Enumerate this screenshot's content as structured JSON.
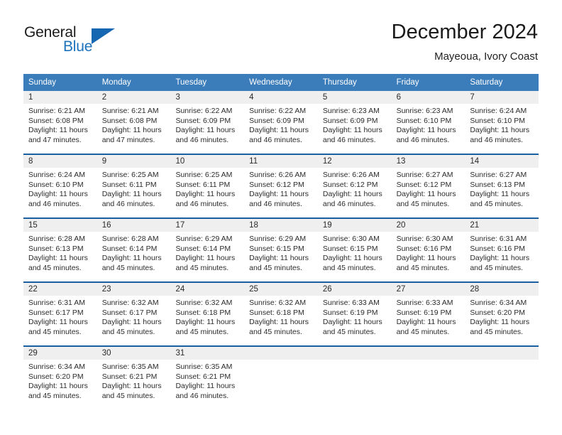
{
  "brand": {
    "name_part1": "General",
    "name_part2": "Blue",
    "triangle_icon": "brand-triangle-icon",
    "accent_color": "#1667b1"
  },
  "header": {
    "title": "December 2024",
    "subtitle": "Mayeoua, Ivory Coast"
  },
  "theme": {
    "header_row_bg": "#3b7cba",
    "week_divider": "#1a5fa0",
    "day_band_bg": "#efefef",
    "text_color": "#2b2b2b"
  },
  "calendar": {
    "weekdays": [
      "Sunday",
      "Monday",
      "Tuesday",
      "Wednesday",
      "Thursday",
      "Friday",
      "Saturday"
    ],
    "weeks": [
      [
        {
          "day": "1",
          "info": "Sunrise: 6:21 AM\nSunset: 6:08 PM\nDaylight: 11 hours\nand 47 minutes."
        },
        {
          "day": "2",
          "info": "Sunrise: 6:21 AM\nSunset: 6:08 PM\nDaylight: 11 hours\nand 47 minutes."
        },
        {
          "day": "3",
          "info": "Sunrise: 6:22 AM\nSunset: 6:09 PM\nDaylight: 11 hours\nand 46 minutes."
        },
        {
          "day": "4",
          "info": "Sunrise: 6:22 AM\nSunset: 6:09 PM\nDaylight: 11 hours\nand 46 minutes."
        },
        {
          "day": "5",
          "info": "Sunrise: 6:23 AM\nSunset: 6:09 PM\nDaylight: 11 hours\nand 46 minutes."
        },
        {
          "day": "6",
          "info": "Sunrise: 6:23 AM\nSunset: 6:10 PM\nDaylight: 11 hours\nand 46 minutes."
        },
        {
          "day": "7",
          "info": "Sunrise: 6:24 AM\nSunset: 6:10 PM\nDaylight: 11 hours\nand 46 minutes."
        }
      ],
      [
        {
          "day": "8",
          "info": "Sunrise: 6:24 AM\nSunset: 6:10 PM\nDaylight: 11 hours\nand 46 minutes."
        },
        {
          "day": "9",
          "info": "Sunrise: 6:25 AM\nSunset: 6:11 PM\nDaylight: 11 hours\nand 46 minutes."
        },
        {
          "day": "10",
          "info": "Sunrise: 6:25 AM\nSunset: 6:11 PM\nDaylight: 11 hours\nand 46 minutes."
        },
        {
          "day": "11",
          "info": "Sunrise: 6:26 AM\nSunset: 6:12 PM\nDaylight: 11 hours\nand 46 minutes."
        },
        {
          "day": "12",
          "info": "Sunrise: 6:26 AM\nSunset: 6:12 PM\nDaylight: 11 hours\nand 46 minutes."
        },
        {
          "day": "13",
          "info": "Sunrise: 6:27 AM\nSunset: 6:12 PM\nDaylight: 11 hours\nand 45 minutes."
        },
        {
          "day": "14",
          "info": "Sunrise: 6:27 AM\nSunset: 6:13 PM\nDaylight: 11 hours\nand 45 minutes."
        }
      ],
      [
        {
          "day": "15",
          "info": "Sunrise: 6:28 AM\nSunset: 6:13 PM\nDaylight: 11 hours\nand 45 minutes."
        },
        {
          "day": "16",
          "info": "Sunrise: 6:28 AM\nSunset: 6:14 PM\nDaylight: 11 hours\nand 45 minutes."
        },
        {
          "day": "17",
          "info": "Sunrise: 6:29 AM\nSunset: 6:14 PM\nDaylight: 11 hours\nand 45 minutes."
        },
        {
          "day": "18",
          "info": "Sunrise: 6:29 AM\nSunset: 6:15 PM\nDaylight: 11 hours\nand 45 minutes."
        },
        {
          "day": "19",
          "info": "Sunrise: 6:30 AM\nSunset: 6:15 PM\nDaylight: 11 hours\nand 45 minutes."
        },
        {
          "day": "20",
          "info": "Sunrise: 6:30 AM\nSunset: 6:16 PM\nDaylight: 11 hours\nand 45 minutes."
        },
        {
          "day": "21",
          "info": "Sunrise: 6:31 AM\nSunset: 6:16 PM\nDaylight: 11 hours\nand 45 minutes."
        }
      ],
      [
        {
          "day": "22",
          "info": "Sunrise: 6:31 AM\nSunset: 6:17 PM\nDaylight: 11 hours\nand 45 minutes."
        },
        {
          "day": "23",
          "info": "Sunrise: 6:32 AM\nSunset: 6:17 PM\nDaylight: 11 hours\nand 45 minutes."
        },
        {
          "day": "24",
          "info": "Sunrise: 6:32 AM\nSunset: 6:18 PM\nDaylight: 11 hours\nand 45 minutes."
        },
        {
          "day": "25",
          "info": "Sunrise: 6:32 AM\nSunset: 6:18 PM\nDaylight: 11 hours\nand 45 minutes."
        },
        {
          "day": "26",
          "info": "Sunrise: 6:33 AM\nSunset: 6:19 PM\nDaylight: 11 hours\nand 45 minutes."
        },
        {
          "day": "27",
          "info": "Sunrise: 6:33 AM\nSunset: 6:19 PM\nDaylight: 11 hours\nand 45 minutes."
        },
        {
          "day": "28",
          "info": "Sunrise: 6:34 AM\nSunset: 6:20 PM\nDaylight: 11 hours\nand 45 minutes."
        }
      ],
      [
        {
          "day": "29",
          "info": "Sunrise: 6:34 AM\nSunset: 6:20 PM\nDaylight: 11 hours\nand 45 minutes."
        },
        {
          "day": "30",
          "info": "Sunrise: 6:35 AM\nSunset: 6:21 PM\nDaylight: 11 hours\nand 45 minutes."
        },
        {
          "day": "31",
          "info": "Sunrise: 6:35 AM\nSunset: 6:21 PM\nDaylight: 11 hours\nand 46 minutes."
        },
        {
          "day": "",
          "info": ""
        },
        {
          "day": "",
          "info": ""
        },
        {
          "day": "",
          "info": ""
        },
        {
          "day": "",
          "info": ""
        }
      ]
    ]
  }
}
